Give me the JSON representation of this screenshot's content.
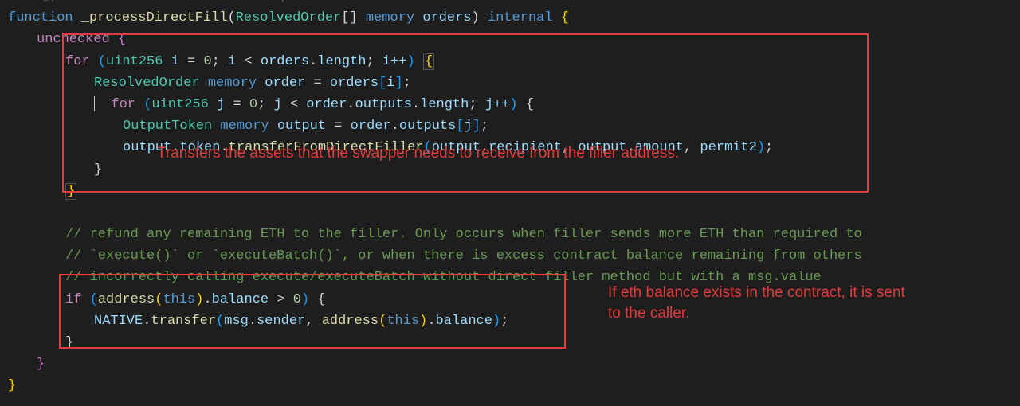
{
  "lines": {
    "l0": "/// @param orders The orders to process",
    "l1_function": "function",
    "l1_name": "_processDirectFill",
    "l1_type": "ResolvedOrder",
    "l1_brackets": "[]",
    "l1_memory": "memory",
    "l1_param": "orders",
    "l1_internal": "internal",
    "l2_unchecked": "unchecked",
    "l3_for": "for",
    "l3_uint": "uint256",
    "l3_i": "i",
    "l3_eq": " = ",
    "l3_zero": "0",
    "l3_semi1": "; ",
    "l3_lt": " < ",
    "l3_orders": "orders",
    "l3_dot": ".",
    "l3_len": "length",
    "l3_semi2": "; ",
    "l3_inc": "i++",
    "l4_type": "ResolvedOrder",
    "l4_memory": "memory",
    "l4_var": "order",
    "l4_eq": " = ",
    "l4_orders": "orders",
    "l4_i": "i",
    "l5_for": "for",
    "l5_uint": "uint256",
    "l5_j": "j",
    "l5_eq": " = ",
    "l5_zero": "0",
    "l5_semi1": "; ",
    "l5_lt": " < ",
    "l5_order": "order",
    "l5_dot": ".",
    "l5_outputs": "outputs",
    "l5_len": "length",
    "l5_semi2": "; ",
    "l5_inc": "j++",
    "l6_type": "OutputToken",
    "l6_memory": "memory",
    "l6_var": "output",
    "l6_eq": " = ",
    "l6_order": "order",
    "l6_outputs": "outputs",
    "l6_j": "j",
    "l7_output": "output",
    "l7_token": "token",
    "l7_method": "transferFromDirectFiller",
    "l7_recipient": "recipient",
    "l7_amount": "amount",
    "l7_permit2": "permit2",
    "comment1": "// refund any remaining ETH to the filler. Only occurs when filler sends more ETH than required to",
    "comment2": "// `execute()` or `executeBatch()`, or when there is excess contract balance remaining from others",
    "comment3": "// incorrectly calling execute/executeBatch without direct filler method but with a msg.value",
    "l11_if": "if",
    "l11_address": "address",
    "l11_this": "this",
    "l11_balance": "balance",
    "l11_gt": " > ",
    "l11_zero": "0",
    "l12_native": "NATIVE",
    "l12_transfer": "transfer",
    "l12_msg": "msg",
    "l12_sender": "sender",
    "l12_address": "address",
    "l12_this": "this",
    "l12_balance": "balance"
  },
  "annotations": {
    "a1": "Transfers the assets that the swapper needs to receive from the filler address.",
    "a2_l1": "If eth balance exists in the contract, it is sent",
    "a2_l2": "to the caller."
  },
  "labels": {
    "cursor": "editor-cursor"
  }
}
